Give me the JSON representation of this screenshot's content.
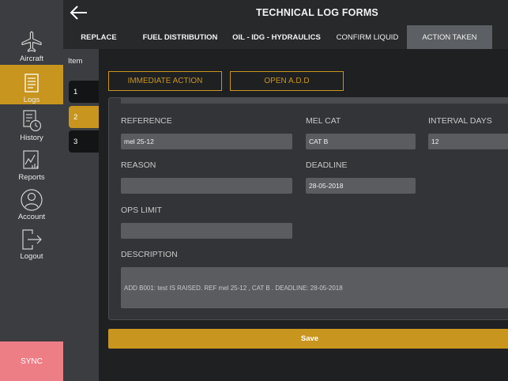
{
  "header": {
    "title": "TECHNICAL LOG FORMS"
  },
  "tabs": [
    {
      "label": "REPLACE"
    },
    {
      "label": "FUEL DISTRIBUTION"
    },
    {
      "label": "OIL - IDG - HYDRAULICS"
    },
    {
      "label": "CONFIRM LIQUID"
    },
    {
      "label": "ACTION TAKEN",
      "active": true
    }
  ],
  "sidebar": {
    "items": [
      {
        "label": "Aircraft",
        "icon": "airplane-icon"
      },
      {
        "label": "Logs",
        "icon": "clipboard-icon",
        "active": true
      },
      {
        "label": "History",
        "icon": "history-icon"
      },
      {
        "label": "Reports",
        "icon": "reports-icon"
      },
      {
        "label": "Account",
        "icon": "user-icon"
      },
      {
        "label": "Logout",
        "icon": "logout-icon"
      }
    ],
    "sync_label": "SYNC"
  },
  "items_panel": {
    "title": "Item",
    "items": [
      "1",
      "2",
      "3"
    ],
    "active_index": 1
  },
  "actions": {
    "immediate_label": "IMMEDIATE ACTION",
    "open_add_label": "OPEN A.D.D"
  },
  "form": {
    "reference_label": "REFERENCE",
    "reference_value": "mel 25-12",
    "mel_cat_label": "MEL CAT",
    "mel_cat_value": "CAT B",
    "interval_label": "INTERVAL DAYS",
    "interval_value": "12",
    "reason_label": "REASON",
    "reason_value": "",
    "deadline_label": "DEADLINE",
    "deadline_value": "28-05-2018",
    "ops_limit_label": "OPS LIMIT",
    "ops_limit_value": "",
    "description_label": "DESCRIPTION",
    "description_value": "ADD B001: test IS RAISED. REF mel 25-12 , CAT B . DEADLINE: 28-05-2018"
  },
  "save_label": "Save",
  "colors": {
    "accent": "#c8951f",
    "sync": "#ee7e86",
    "sidebar": "#3b3d40",
    "background": "#1f2022"
  }
}
